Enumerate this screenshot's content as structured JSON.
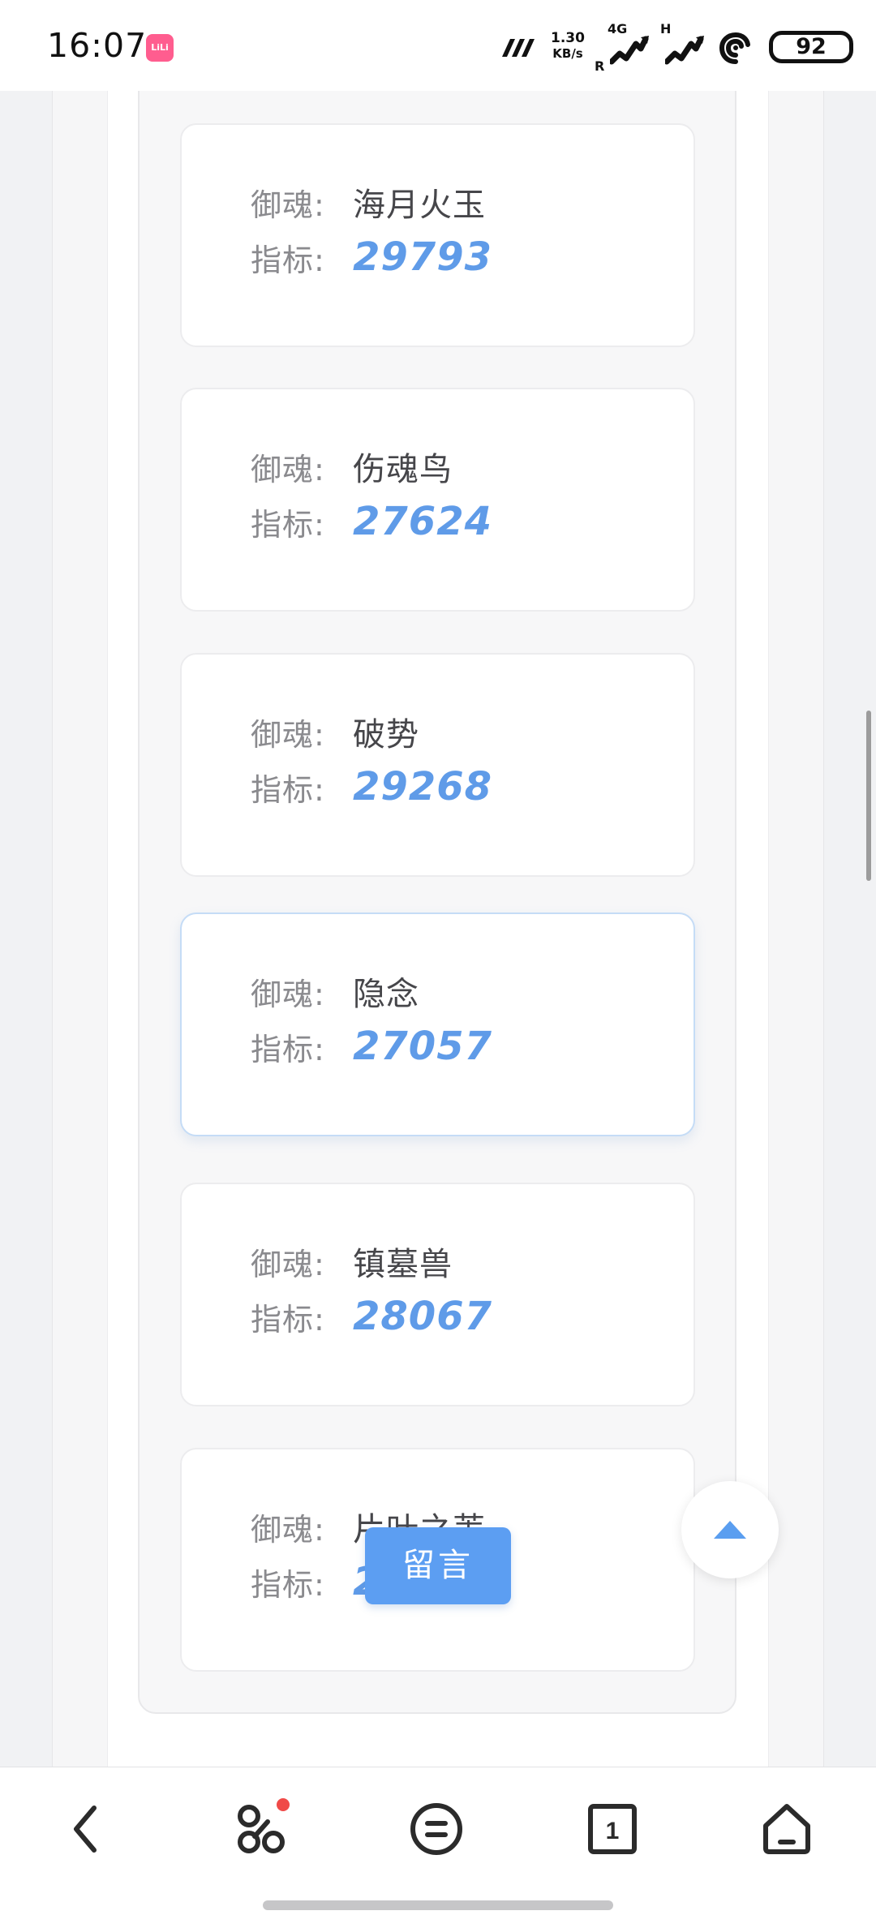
{
  "status_bar": {
    "time": "16:07",
    "app_badge": "LiLi",
    "net_speed_value": "1.30",
    "net_speed_unit": "KB/s",
    "sim1_label": "4G",
    "sim1_sub": "R",
    "sim2_label": "H",
    "battery": "92"
  },
  "cards": [
    {
      "soul_label": "御魂:",
      "soul": "海月火玉",
      "metric_label": "指标:",
      "metric": "29793"
    },
    {
      "soul_label": "御魂:",
      "soul": "伤魂鸟",
      "metric_label": "指标:",
      "metric": "27624"
    },
    {
      "soul_label": "御魂:",
      "soul": "破势",
      "metric_label": "指标:",
      "metric": "29268"
    },
    {
      "soul_label": "御魂:",
      "soul": "隐念",
      "metric_label": "指标:",
      "metric": "27057"
    },
    {
      "soul_label": "御魂:",
      "soul": "镇墓兽",
      "metric_label": "指标:",
      "metric": "28067"
    },
    {
      "soul_label": "御魂:",
      "soul": "片叶之苇",
      "metric_label": "指标:",
      "metric": "28348"
    }
  ],
  "actions": {
    "message_button": "留言"
  },
  "nav": {
    "tabs_count": "1"
  },
  "colors": {
    "accent": "#5c9ef2",
    "metric_text": "#5f9be8",
    "label_text": "#8a8a8e"
  }
}
